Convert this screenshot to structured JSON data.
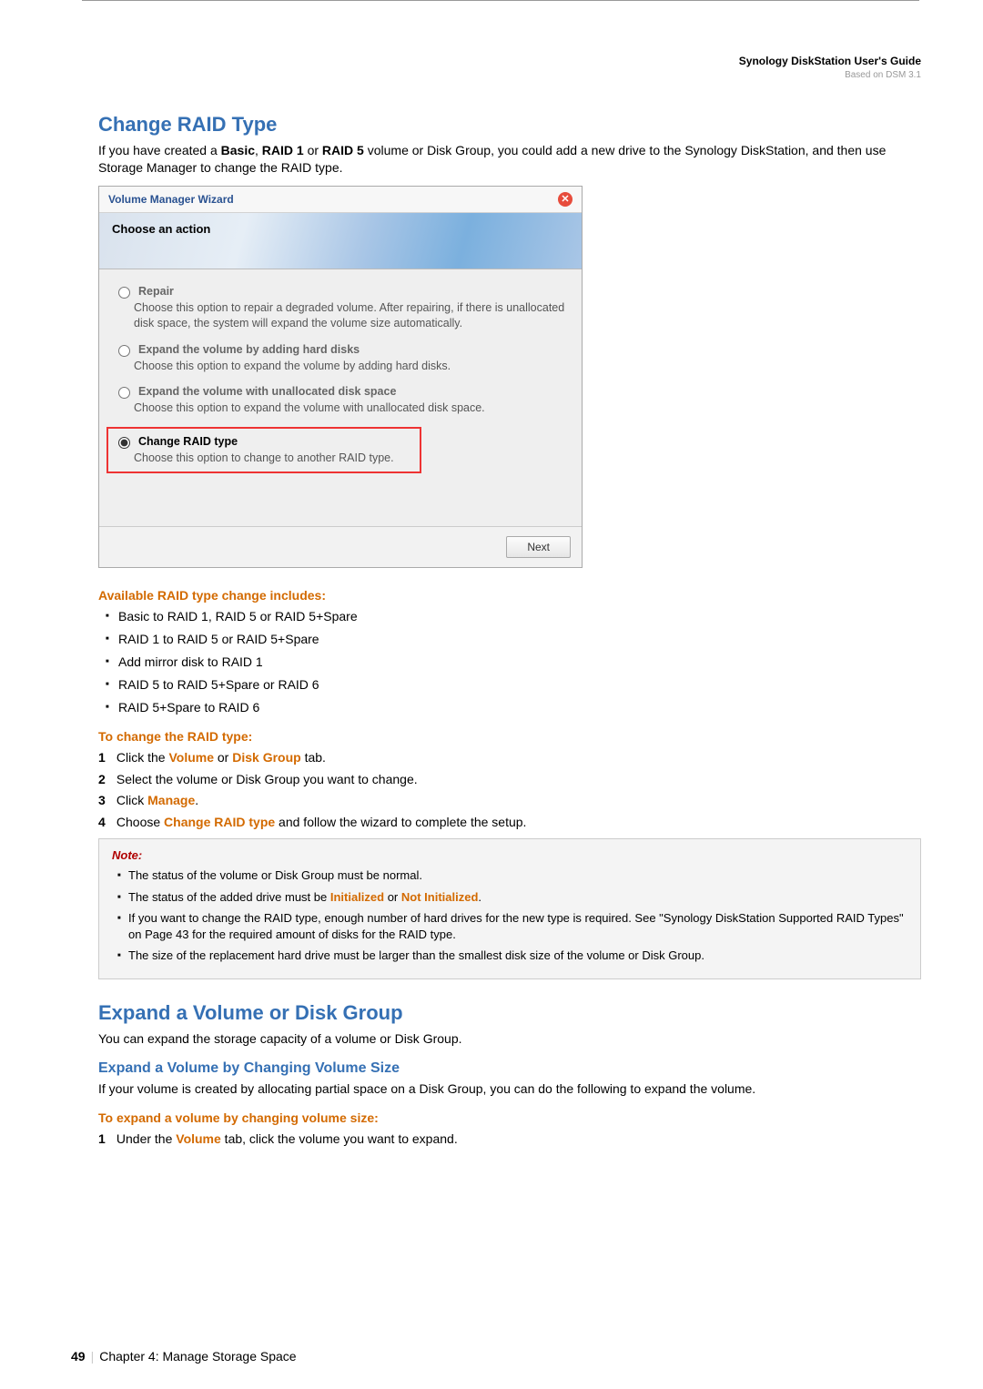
{
  "header": {
    "title": "Synology DiskStation User's Guide",
    "sub": "Based on DSM 3.1"
  },
  "section1": {
    "title": "Change RAID Type",
    "intro_pre": "If you have created a ",
    "bold1": "Basic",
    "sep1": ", ",
    "bold2": "RAID 1",
    "sep2": " or ",
    "bold3": "RAID 5",
    "intro_post": " volume or Disk Group, you could add a new drive to the Synology DiskStation, and then use Storage Manager to change the RAID type."
  },
  "wizard": {
    "title": "Volume Manager Wizard",
    "banner": "Choose an action",
    "opt1": {
      "label": "Repair",
      "desc": "Choose this option to repair a degraded volume. After repairing, if there is unallocated disk space, the system will expand the volume size automatically."
    },
    "opt2": {
      "label": "Expand the volume by adding hard disks",
      "desc": "Choose this option to expand the volume by adding hard disks."
    },
    "opt3": {
      "label": "Expand the volume with unallocated disk space",
      "desc": "Choose this option to expand the volume with unallocated disk space."
    },
    "opt4": {
      "label": "Change RAID type",
      "desc": "Choose this option to change to another RAID type."
    },
    "next": "Next"
  },
  "avail": {
    "title": "Available RAID type change includes:",
    "item1": "Basic to RAID 1, RAID 5 or RAID 5+Spare",
    "item2": "RAID 1 to RAID 5 or RAID 5+Spare",
    "item3": "Add mirror disk to RAID 1",
    "item4": "RAID 5 to RAID 5+Spare or RAID 6",
    "item5": "RAID 5+Spare to RAID 6"
  },
  "tochange": {
    "title": "To change the RAID type:",
    "s1_num": "1",
    "s1_pre": "Click the ",
    "s1_link1": "Volume",
    "s1_mid": " or ",
    "s1_link2": "Disk Group",
    "s1_post": " tab.",
    "s2_num": "2",
    "s2": "Select the volume or Disk Group you want to change.",
    "s3_num": "3",
    "s3_pre": "Click ",
    "s3_link": "Manage",
    "s3_post": ".",
    "s4_num": "4",
    "s4_pre": "Choose ",
    "s4_link": "Change RAID type",
    "s4_post": " and follow the wizard to complete the setup."
  },
  "note": {
    "title": "Note:",
    "n1": "The status of the volume or Disk Group must be normal.",
    "n2_pre": "The status of the added drive must be ",
    "n2_link1": "Initialized",
    "n2_mid": " or ",
    "n2_link2": "Not Initialized",
    "n2_post": ".",
    "n3": "If you want to change the RAID type, enough number of hard drives for the new type is required. See \"Synology DiskStation Supported RAID Types\" on Page 43 for the required amount of disks for the RAID type.",
    "n4": "The size of the replacement hard drive must be larger than the smallest disk size of the volume or Disk Group."
  },
  "section2": {
    "title": "Expand a Volume or Disk Group",
    "intro": "You can expand the storage capacity of a volume or Disk Group.",
    "sub": "Expand a Volume by Changing Volume Size",
    "subintro": "If your volume is created by allocating partial space on a Disk Group, you can do the following to expand the volume.",
    "stepsTitle": "To expand a volume by changing volume size:",
    "s1_num": "1",
    "s1_pre": "Under the ",
    "s1_link": "Volume",
    "s1_post": " tab, click the volume you want to expand."
  },
  "footer": {
    "page": "49",
    "chapter": "Chapter 4: Manage Storage Space"
  }
}
